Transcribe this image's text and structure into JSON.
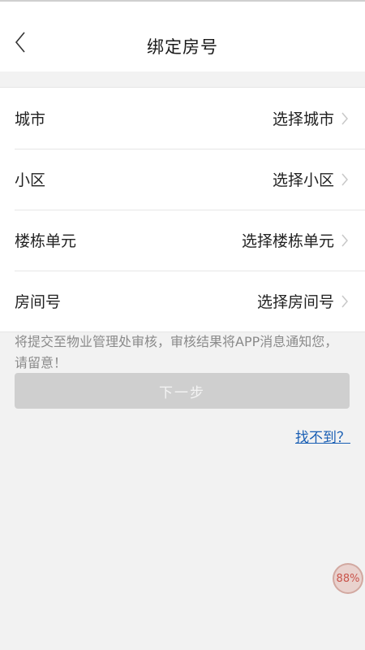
{
  "header": {
    "title": "绑定房号",
    "back_icon": "chevron-left-icon"
  },
  "form": {
    "rows": [
      {
        "label": "城市",
        "value": "选择城市"
      },
      {
        "label": "小区",
        "value": "选择小区"
      },
      {
        "label": "楼栋单元",
        "value": "选择楼栋单元"
      },
      {
        "label": "房间号",
        "value": "选择房间号"
      }
    ]
  },
  "notice": "将提交至物业管理处审核，审核结果将APP消息通知您，请留意！",
  "actions": {
    "next_label": "下一步",
    "not_found_label": "找不到？"
  },
  "overlay": {
    "percent_label": "88%"
  },
  "colors": {
    "background": "#f2f2f2",
    "button_disabled": "#cfcfcf",
    "link": "#1a5fb4",
    "hint_text": "#8a8a8a"
  }
}
